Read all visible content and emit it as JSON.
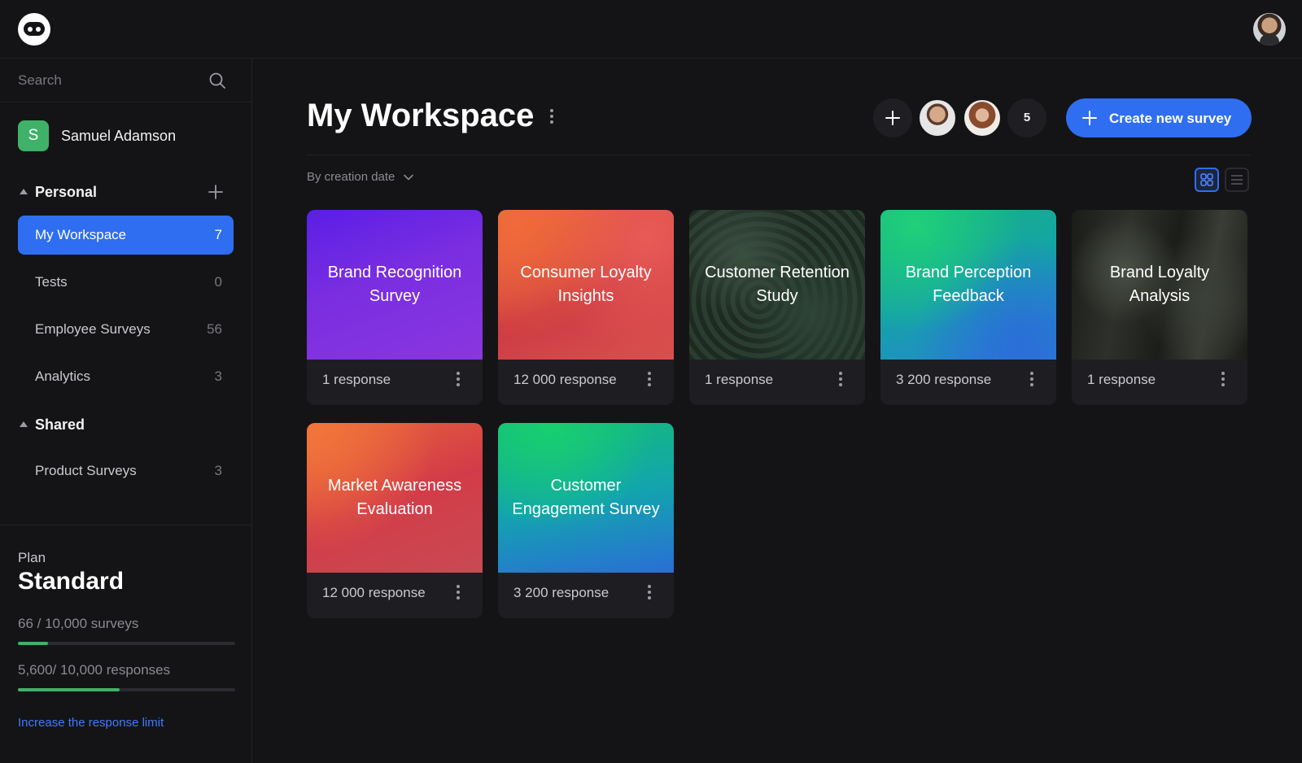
{
  "header": {
    "logo_icon": "chat-bubble-eyes-logo",
    "avatar_icon": "user-avatar"
  },
  "sidebar": {
    "search": {
      "placeholder": "Search",
      "icon": "search-icon"
    },
    "profile": {
      "initial": "S",
      "name": "Samuel Adamson",
      "badge_color": "#3fb168"
    },
    "sections": [
      {
        "label": "Personal",
        "items": [
          {
            "label": "My Workspace",
            "count": "7",
            "active": true
          },
          {
            "label": "Tests",
            "count": "0"
          },
          {
            "label": "Employee Surveys",
            "count": "56"
          },
          {
            "label": "Analytics",
            "count": "3"
          }
        ]
      },
      {
        "label": "Shared",
        "items": [
          {
            "label": "Product Surveys",
            "count": "3"
          }
        ]
      }
    ],
    "plan": {
      "label": "Plan",
      "name": "Standard",
      "surveys_text": "66 / 10,000 surveys",
      "surveys_fraction": 0.14,
      "responses_text": "5,600/ 10,000 responses",
      "responses_fraction": 0.47,
      "link": "Increase the response limit"
    }
  },
  "main": {
    "title": "My Workspace",
    "members_more": "5",
    "create_button": "Create new survey",
    "sort_label": "By creation date",
    "accent_color": "#2f6ef1",
    "cards": [
      {
        "title": "Brand Recognition Survey",
        "responses": "1 response"
      },
      {
        "title": "Consumer Loyalty Insights",
        "responses": "12 000 response"
      },
      {
        "title": "Customer Retention Study",
        "responses": "1 response"
      },
      {
        "title": "Brand Perception Feedback",
        "responses": "3 200 response"
      },
      {
        "title": "Brand Loyalty Analysis",
        "responses": "1 response"
      },
      {
        "title": "Market Awareness Evaluation",
        "responses": "12 000 response"
      },
      {
        "title": "Customer Engagement Survey",
        "responses": "3 200 response"
      }
    ]
  }
}
